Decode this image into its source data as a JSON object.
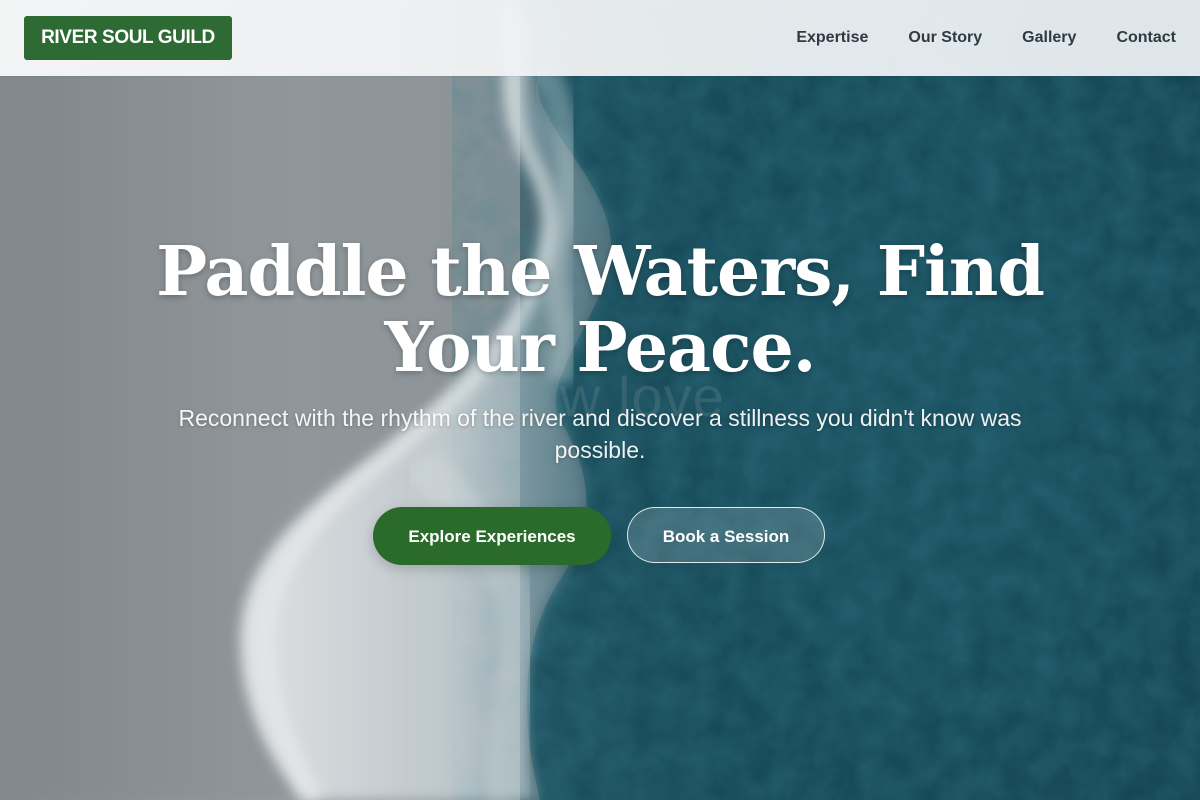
{
  "header": {
    "brand": "RIVER SOUL GUILD",
    "nav": [
      {
        "label": "Expertise"
      },
      {
        "label": "Our Story"
      },
      {
        "label": "Gallery"
      },
      {
        "label": "Contact"
      }
    ]
  },
  "hero": {
    "title": "Paddle the Waters, Find Your Peace.",
    "ghost_text": "w love",
    "subtitle": "Reconnect with the rhythm of the river and discover a stillness you didn't know was possible.",
    "primary_cta": "Explore Experiences",
    "secondary_cta": "Book a Session"
  },
  "colors": {
    "brand_green": "#2e6b34",
    "primary_button": "#2a6b2c",
    "ocean_deep": "#1c5563",
    "sand": "#9ea3a6",
    "nav_text": "#2f3a44"
  }
}
